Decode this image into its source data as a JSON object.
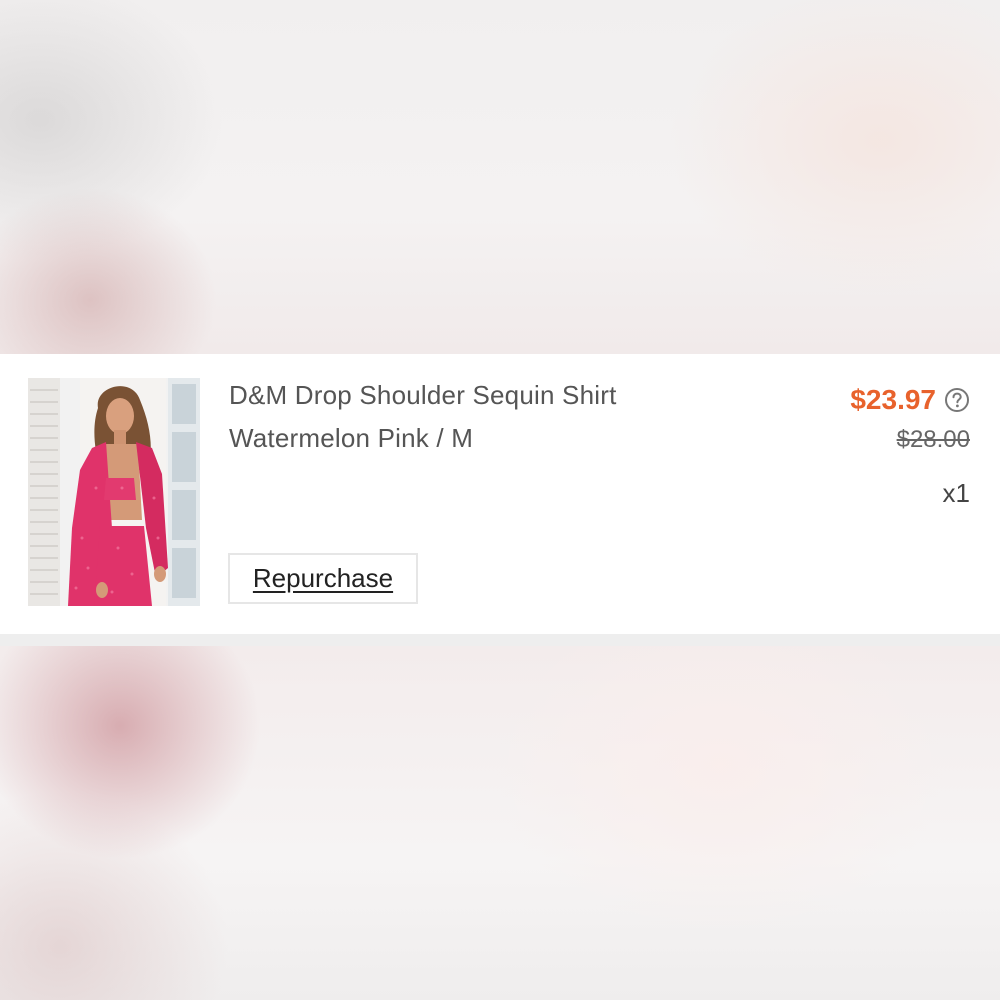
{
  "order_item": {
    "product_name": "D&M Drop Shoulder Sequin Shirt",
    "variant": "Watermelon Pink / M",
    "price": "$23.97",
    "original_price": "$28.00",
    "quantity": "x1",
    "repurchase_label": "Repurchase",
    "image_icon": "product-photo",
    "help_icon": "question-circle-icon"
  },
  "colors": {
    "price": "#e8622c",
    "product": "#e0336a"
  }
}
